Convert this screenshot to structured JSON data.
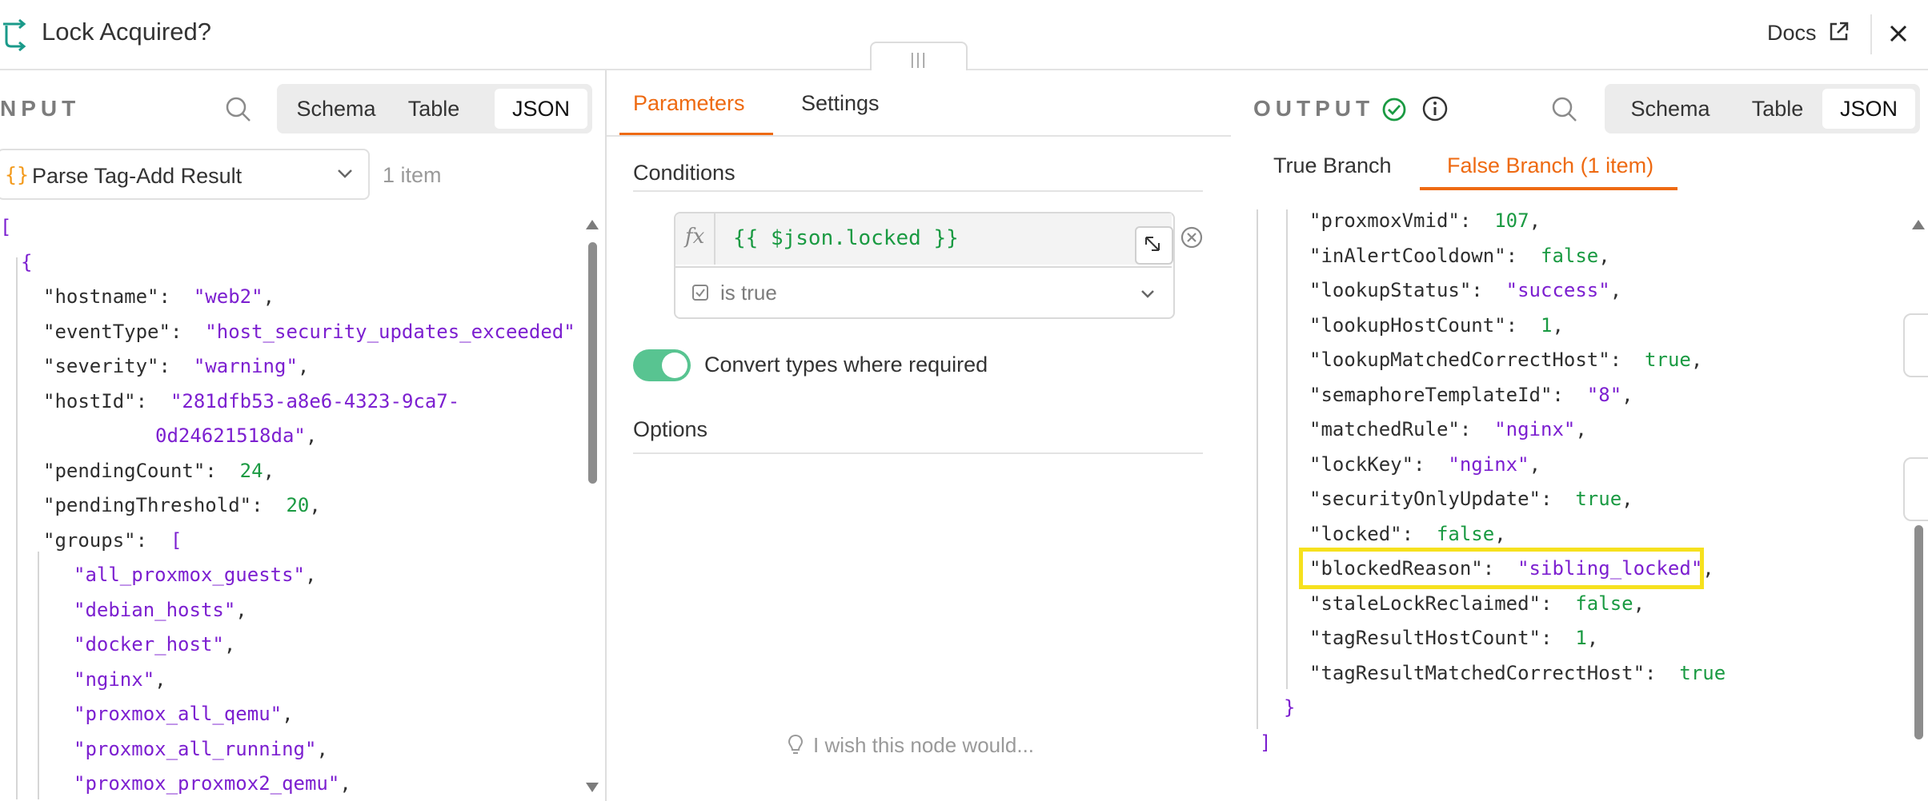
{
  "header": {
    "title": "Lock Acquired?",
    "docs_label": "Docs"
  },
  "drag_handle": "|||",
  "input": {
    "label": "NPUT",
    "views": [
      "Schema",
      "Table",
      "JSON"
    ],
    "active_view": "JSON",
    "source_node": "Parse Tag-Add Result",
    "item_count": "1 item",
    "lines": [
      {
        "t": "open",
        "text": "["
      },
      {
        "t": "open",
        "text": "{"
      },
      {
        "t": "kv",
        "key": "\"hostname\":",
        "val": "\"web2\"",
        "vt": "s",
        "tail": ","
      },
      {
        "t": "kv",
        "key": "\"eventType\":",
        "val": "\"host_security_updates_exceeded\"",
        "vt": "s",
        "tail": ","
      },
      {
        "t": "kv",
        "key": "\"severity\":",
        "val": "\"warning\"",
        "vt": "s",
        "tail": ","
      },
      {
        "t": "kv",
        "key": "\"hostId\":",
        "val": "\"281dfb53-a8e6-4323-9ca7-",
        "vt": "s",
        "tail": ""
      },
      {
        "t": "cont",
        "val": "0d24621518da\"",
        "vt": "s",
        "tail": ","
      },
      {
        "t": "kv",
        "key": "\"pendingCount\":",
        "val": "24",
        "vt": "n",
        "tail": ","
      },
      {
        "t": "kv",
        "key": "\"pendingThreshold\":",
        "val": "20",
        "vt": "n",
        "tail": ","
      },
      {
        "t": "kv",
        "key": "\"groups\":",
        "val": "[",
        "vt": "s",
        "tail": ""
      },
      {
        "t": "arr",
        "val": "\"all_proxmox_guests\"",
        "vt": "s",
        "tail": ","
      },
      {
        "t": "arr",
        "val": "\"debian_hosts\"",
        "vt": "s",
        "tail": ","
      },
      {
        "t": "arr",
        "val": "\"docker_host\"",
        "vt": "s",
        "tail": ","
      },
      {
        "t": "arr",
        "val": "\"nginx\"",
        "vt": "s",
        "tail": ","
      },
      {
        "t": "arr",
        "val": "\"proxmox_all_qemu\"",
        "vt": "s",
        "tail": ","
      },
      {
        "t": "arr",
        "val": "\"proxmox_all_running\"",
        "vt": "s",
        "tail": ","
      },
      {
        "t": "arr",
        "val": "\"proxmox_proxmox2_qemu\"",
        "vt": "s",
        "tail": ","
      }
    ]
  },
  "params": {
    "tabs": [
      "Parameters",
      "Settings"
    ],
    "active_tab": "Parameters",
    "conditions_label": "Conditions",
    "expression": "{{ $json.locked }}",
    "operator": "is true",
    "convert_label": "Convert types where required",
    "convert_enabled": true,
    "options_label": "Options",
    "wish_text": "I wish this node would..."
  },
  "output": {
    "label": "OUTPUT",
    "views": [
      "Schema",
      "Table",
      "JSON"
    ],
    "active_view": "JSON",
    "branches": [
      "True Branch",
      "False Branch (1 item)"
    ],
    "active_branch": "False Branch (1 item)",
    "lines": [
      {
        "key": "\"proxmoxVmid\":",
        "val": "107",
        "vt": "n",
        "tail": ","
      },
      {
        "key": "\"inAlertCooldown\":",
        "val": "false",
        "vt": "b",
        "tail": ","
      },
      {
        "key": "\"lookupStatus\":",
        "val": "\"success\"",
        "vt": "s",
        "tail": ","
      },
      {
        "key": "\"lookupHostCount\":",
        "val": "1",
        "vt": "n",
        "tail": ","
      },
      {
        "key": "\"lookupMatchedCorrectHost\":",
        "val": "true",
        "vt": "b",
        "tail": ","
      },
      {
        "key": "\"semaphoreTemplateId\":",
        "val": "\"8\"",
        "vt": "s",
        "tail": ","
      },
      {
        "key": "\"matchedRule\":",
        "val": "\"nginx\"",
        "vt": "s",
        "tail": ","
      },
      {
        "key": "\"lockKey\":",
        "val": "\"nginx\"",
        "vt": "s",
        "tail": ","
      },
      {
        "key": "\"securityOnlyUpdate\":",
        "val": "true",
        "vt": "b",
        "tail": ","
      },
      {
        "key": "\"locked\":",
        "val": "false",
        "vt": "b",
        "tail": ","
      },
      {
        "key": "\"blockedReason\":",
        "val": "\"sibling_locked\"",
        "vt": "s",
        "tail": ","
      },
      {
        "key": "\"staleLockReclaimed\":",
        "val": "false",
        "vt": "b",
        "tail": ","
      },
      {
        "key": "\"tagResultHostCount\":",
        "val": "1",
        "vt": "n",
        "tail": ","
      },
      {
        "key": "\"tagResultMatchedCorrectHost\":",
        "val": "true",
        "vt": "b",
        "tail": ""
      }
    ],
    "close_object": "}",
    "close_array": "]"
  },
  "colors": {
    "accent": "#ee6a12",
    "string": "#7c1fd0",
    "number": "#1a9a42",
    "highlight": "#f6e11e",
    "success": "#1a9a42"
  }
}
